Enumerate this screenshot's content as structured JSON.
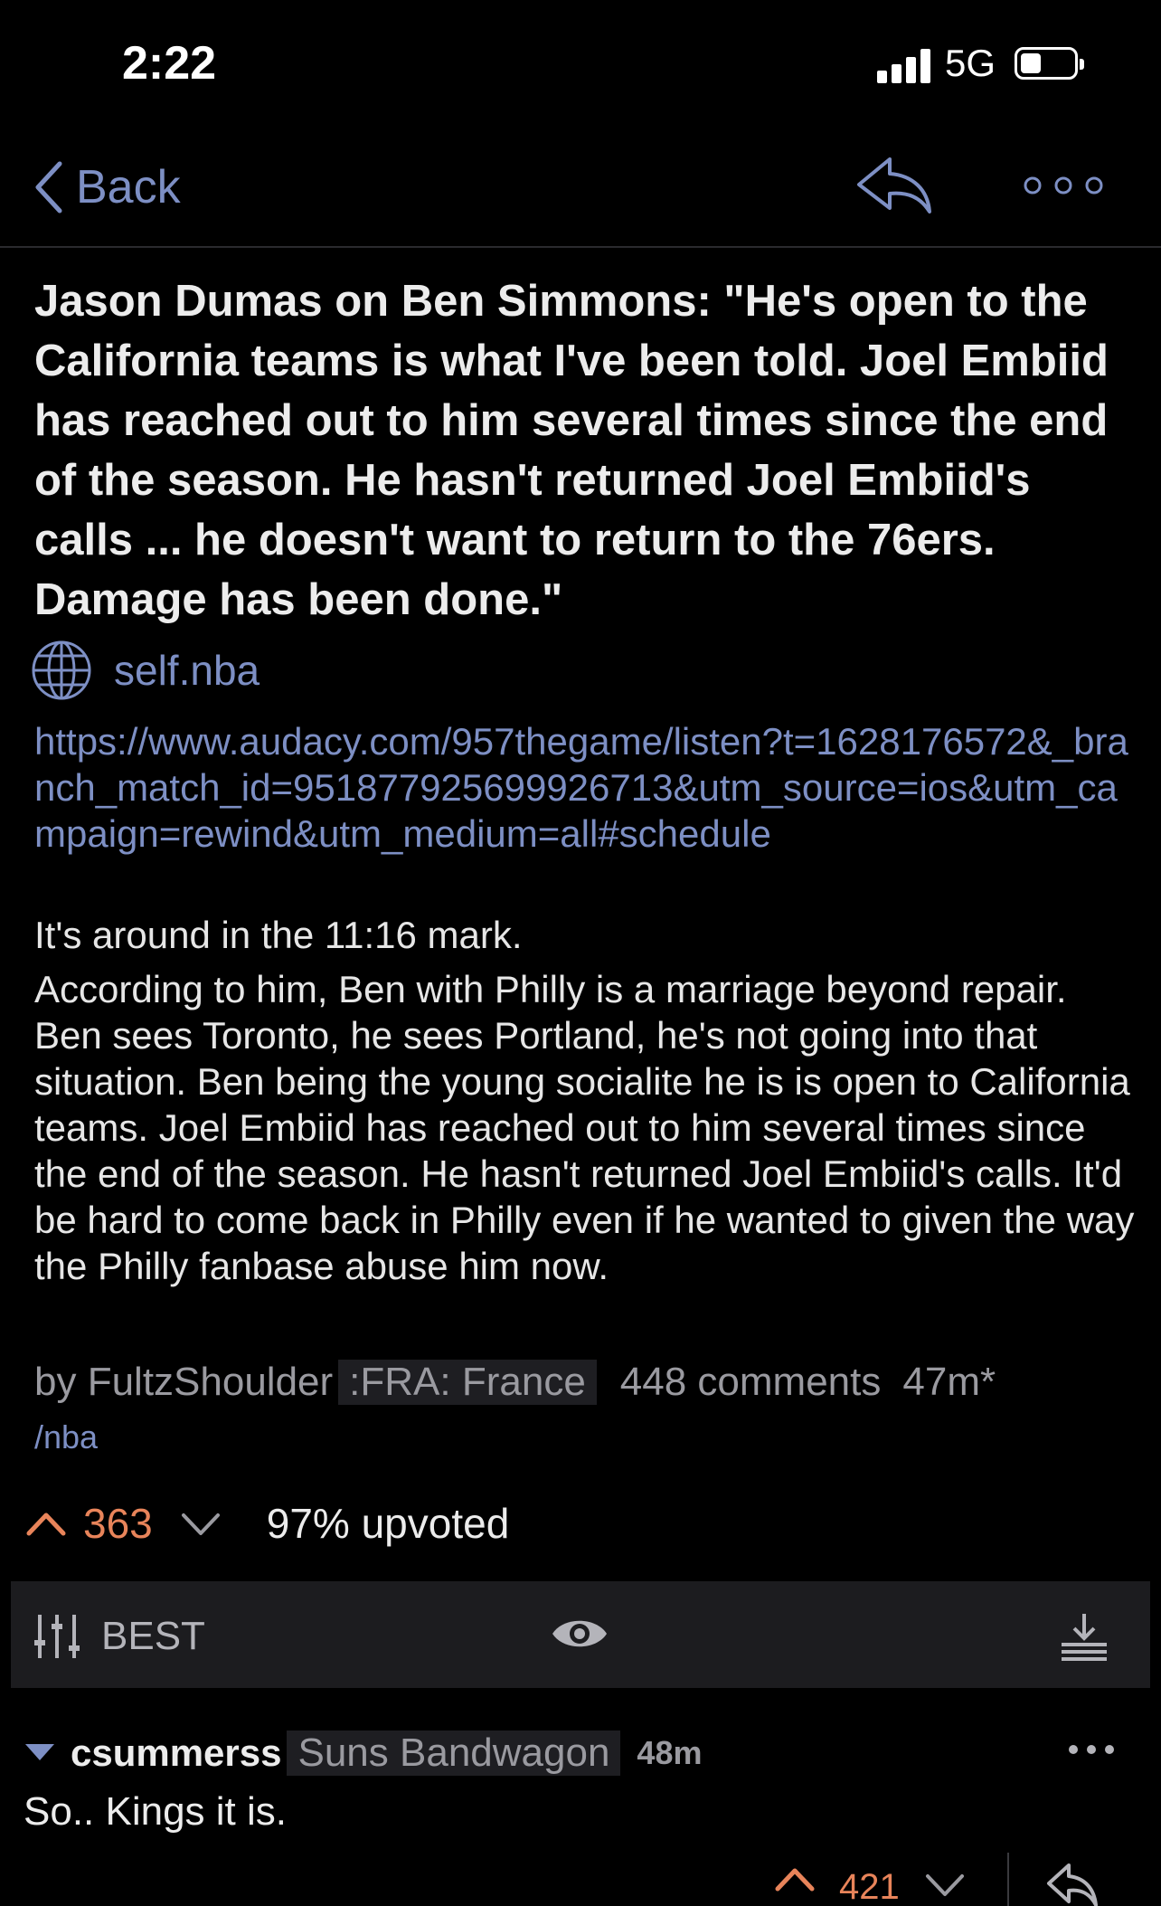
{
  "status_bar": {
    "time": "2:22",
    "network": "5G"
  },
  "nav": {
    "back_label": "Back",
    "accent_color": "#7d8fc4"
  },
  "post": {
    "title": "Jason Dumas on Ben Simmons: \"He's open to the California teams is what I've been told. Joel Embiid has reached out to him several times since the end of the season. He hasn't returned Joel Embiid's calls ... he doesn't want to return to the 76ers. Damage has been done.\"",
    "domain": "self.nba",
    "link": "https://www.audacy.com/957thegame/listen?t=1628176572&_branch_match_id=951877925699926713&utm_source=ios&utm_campaign=rewind&utm_medium=all#schedule",
    "body_paragraph_1": "It's around in the 11:16 mark.",
    "body_paragraph_2": "According to him, Ben with Philly is a marriage beyond repair. Ben sees Toronto, he sees Portland, he's not going into that situation. Ben being the young socialite he is is open to California teams. Joel Embiid has reached out to him several times since the end of the season. He hasn't returned Joel Embiid's calls. It'd be hard to come back in Philly even if he wanted to given the way the Philly fanbase abuse him now.",
    "author": "by FultzShoulder",
    "author_flair": ":FRA: France",
    "comments": "448 comments",
    "age": "47m*",
    "subreddit": "/nba",
    "score": "363",
    "upvote_ratio": "97% upvoted",
    "upvote_color": "#e8845a"
  },
  "toolbar": {
    "sort_label": "BEST"
  },
  "comment": {
    "author": "csummerss",
    "flair": "Suns Bandwagon",
    "age": "48m",
    "body": "So.. Kings it is.",
    "score": "421"
  }
}
